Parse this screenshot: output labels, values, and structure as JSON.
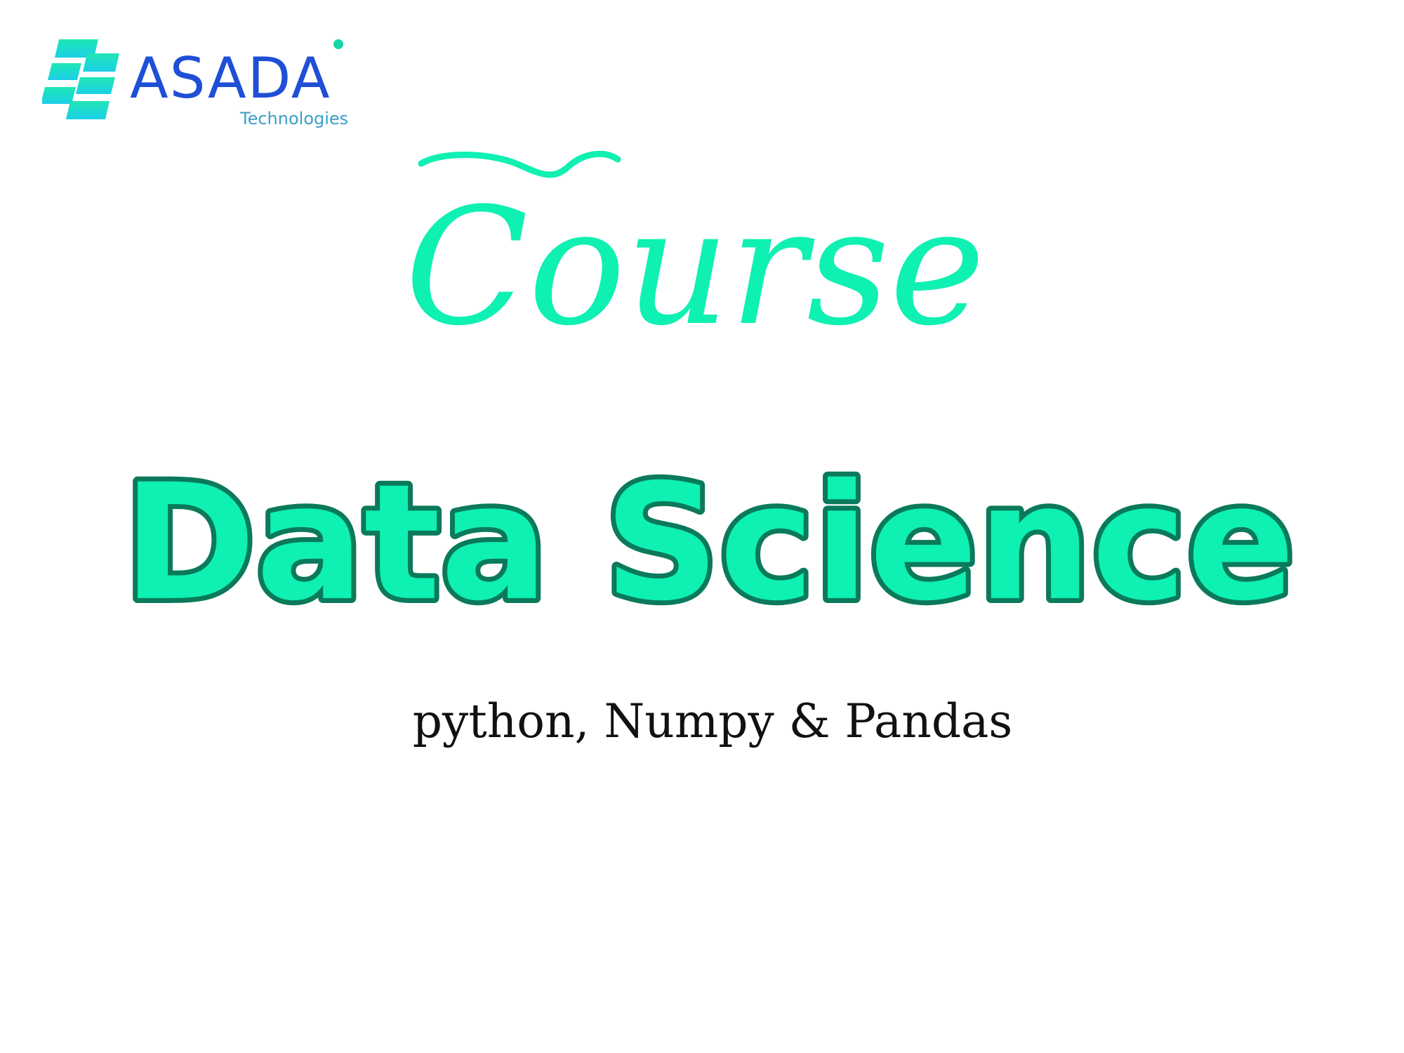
{
  "logo": {
    "name": "ASADA",
    "tagline": "Technologies",
    "mark_icon": "stacked-parallelogram-icon"
  },
  "heading": {
    "script_word": "Course",
    "title": "Data Science",
    "subtitle": "python, Numpy & Pandas"
  },
  "colors": {
    "accent_mint": "#0ff0b3",
    "outline_dark_green": "#0a7a5a",
    "logo_blue": "#1f4fd6",
    "logo_cyan": "#19d6c8",
    "tagline_blue": "#3aa0c8",
    "text_black": "#111111",
    "background": "#ffffff"
  }
}
